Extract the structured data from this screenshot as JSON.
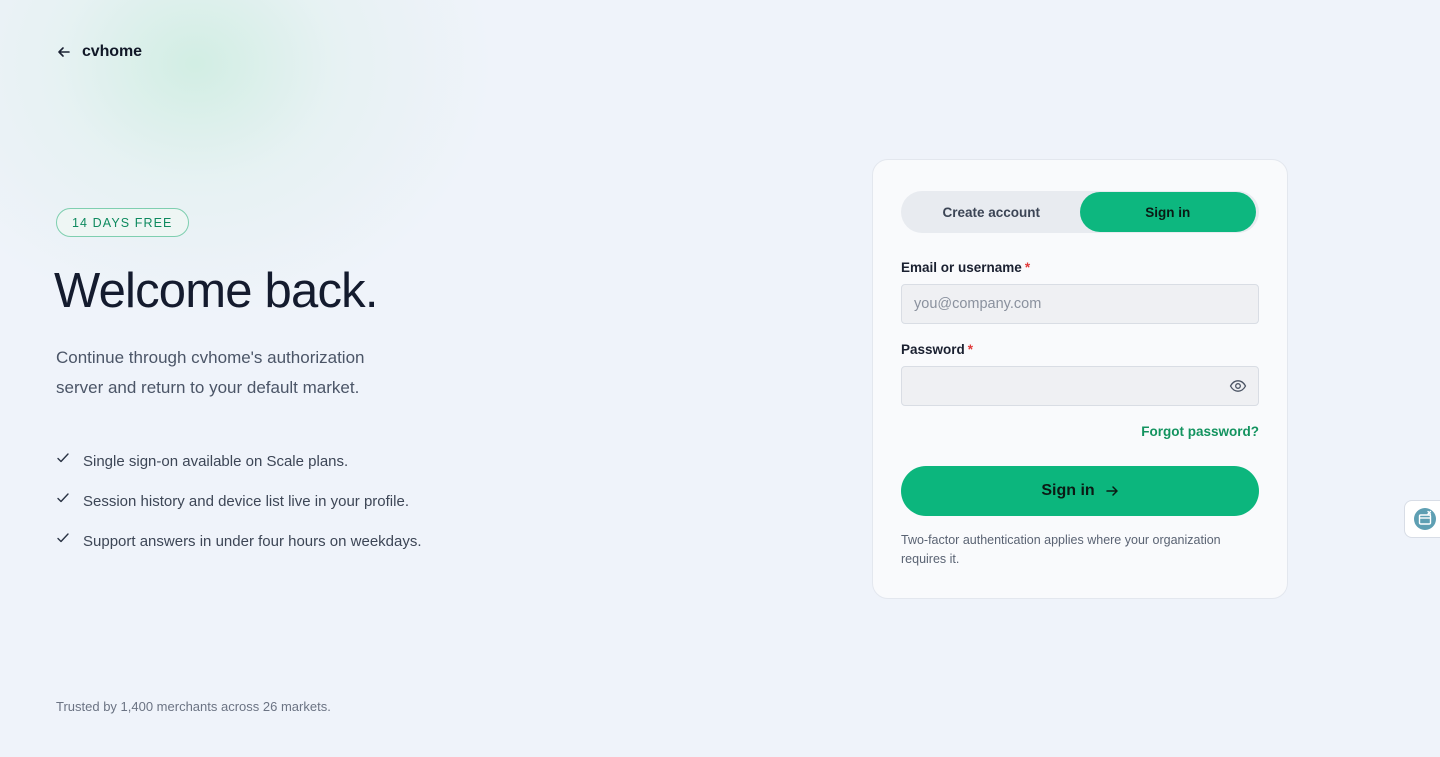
{
  "brand": {
    "name": "cvhome"
  },
  "hero": {
    "badge": "14 DAYS FREE",
    "title": "Welcome back.",
    "subtitle": "Continue through cvhome's authorization server and return to your default market.",
    "features": [
      "Single sign-on available on Scale plans.",
      "Session history and device list live in your profile.",
      "Support answers in under four hours on weekdays."
    ],
    "trusted": "Trusted by 1,400 merchants across 26 markets."
  },
  "auth": {
    "tabs": [
      {
        "label": "Create account",
        "active": false
      },
      {
        "label": "Sign in",
        "active": true
      }
    ],
    "email": {
      "label": "Email or username",
      "required_mark": "*",
      "placeholder": "you@company.com",
      "value": ""
    },
    "password": {
      "label": "Password",
      "required_mark": "*",
      "value": ""
    },
    "forgot_label": "Forgot password?",
    "submit_label": "Sign in",
    "note": "Two-factor authentication applies where your organization requires it."
  },
  "icons": {
    "back": "arrow-left-icon",
    "feature": "check-icon",
    "password_toggle": "eye-icon",
    "submit": "arrow-right-icon",
    "side_widget": "widget-icon"
  },
  "colors": {
    "accent": "#0cb67d",
    "link": "#13935f",
    "required": "#e03a3a",
    "background": "#eff3fa"
  }
}
